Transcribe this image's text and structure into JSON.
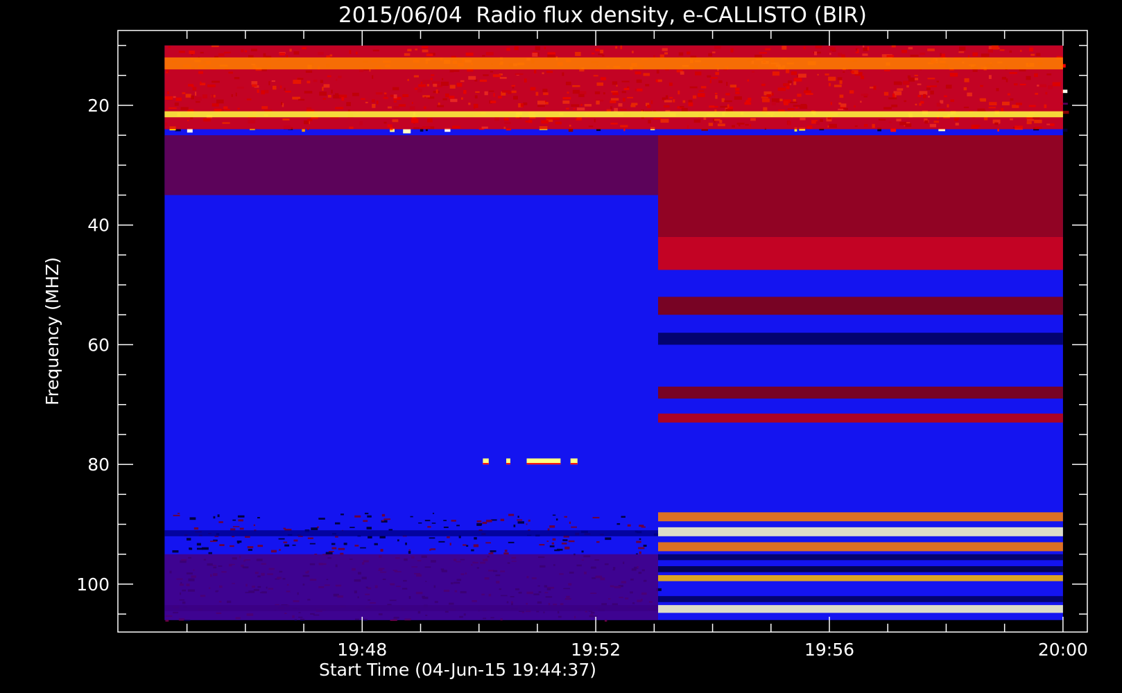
{
  "chart_data": {
    "type": "heatmap",
    "title": "2015/06/04  Radio flux density, e-CALLISTO (BIR)",
    "xlabel": "Start Time (04-Jun-15 19:44:37)",
    "ylabel": "Frequency (MHZ)",
    "x_unit": "minutes",
    "x_ticks": [
      {
        "value": 3.383,
        "label": "19:48"
      },
      {
        "value": 7.383,
        "label": "19:52"
      },
      {
        "value": 11.383,
        "label": "19:56"
      },
      {
        "value": 15.383,
        "label": "20:00"
      }
    ],
    "x_minor_ticks": [
      0.383,
      1.383,
      2.383,
      4.383,
      5.383,
      6.383,
      8.383,
      9.383,
      10.383,
      12.383,
      13.383,
      14.383
    ],
    "xlim": [
      -0.8,
      15.8
    ],
    "data_x_range": [
      0,
      15.383
    ],
    "segment_change_x": 8.45,
    "y_ticks": [
      {
        "value": 20,
        "label": "20"
      },
      {
        "value": 40,
        "label": "40"
      },
      {
        "value": 60,
        "label": "60"
      },
      {
        "value": 80,
        "label": "80"
      },
      {
        "value": 100,
        "label": "100"
      }
    ],
    "y_minor_ticks": [
      10,
      15,
      25,
      30,
      35,
      45,
      50,
      55,
      65,
      70,
      75,
      85,
      90,
      95,
      105
    ],
    "ylim": [
      7.5,
      108
    ],
    "data_y_range": [
      10,
      106
    ],
    "y_inverted": true,
    "colorscale": [
      "#000020",
      "#0000ff",
      "#8a0000",
      "#ff0000",
      "#ffff00",
      "#ffffff"
    ],
    "background_color": "#1414f0",
    "bands": [
      {
        "y_from": 10,
        "y_to": 24,
        "x_from": 0,
        "x_to": 15.383,
        "intensity": 0.55
      },
      {
        "y_from": 12,
        "y_to": 14,
        "x_from": 0,
        "x_to": 15.383,
        "intensity": 0.7
      },
      {
        "y_from": 21,
        "y_to": 22,
        "x_from": 0,
        "x_to": 15.383,
        "intensity": 0.85
      },
      {
        "y_from": 25,
        "y_to": 35,
        "x_from": 0,
        "x_to": 8.45,
        "intensity": 0.35
      },
      {
        "y_from": 25,
        "y_to": 42,
        "x_from": 8.45,
        "x_to": 15.383,
        "intensity": 0.45
      },
      {
        "y_from": 42,
        "y_to": 47.5,
        "x_from": 8.45,
        "x_to": 15.383,
        "intensity": 0.55
      },
      {
        "y_from": 52,
        "y_to": 55,
        "x_from": 8.45,
        "x_to": 15.383,
        "intensity": 0.4
      },
      {
        "y_from": 58,
        "y_to": 60,
        "x_from": 8.45,
        "x_to": 15.383,
        "intensity": 0.05
      },
      {
        "y_from": 67,
        "y_to": 69,
        "x_from": 8.45,
        "x_to": 15.383,
        "intensity": 0.4
      },
      {
        "y_from": 71.5,
        "y_to": 73,
        "x_from": 8.45,
        "x_to": 15.383,
        "intensity": 0.5
      },
      {
        "y_from": 88,
        "y_to": 89.5,
        "x_from": 8.45,
        "x_to": 15.383,
        "intensity": 0.7
      },
      {
        "y_from": 90.5,
        "y_to": 92,
        "x_from": 8.45,
        "x_to": 15.383,
        "intensity": 0.95
      },
      {
        "y_from": 93,
        "y_to": 94.5,
        "x_from": 8.45,
        "x_to": 15.383,
        "intensity": 0.7
      },
      {
        "y_from": 95,
        "y_to": 96,
        "x_from": 8.45,
        "x_to": 15.383,
        "intensity": 0.05
      },
      {
        "y_from": 97,
        "y_to": 98,
        "x_from": 8.45,
        "x_to": 15.383,
        "intensity": 0.02
      },
      {
        "y_from": 98.5,
        "y_to": 99.5,
        "x_from": 8.45,
        "x_to": 15.383,
        "intensity": 0.75
      },
      {
        "y_from": 102,
        "y_to": 103,
        "x_from": 8.45,
        "x_to": 15.383,
        "intensity": 0.05
      },
      {
        "y_from": 103.5,
        "y_to": 104.8,
        "x_from": 8.45,
        "x_to": 15.383,
        "intensity": 0.95
      },
      {
        "y_from": 91,
        "y_to": 92,
        "x_from": 0,
        "x_to": 8.45,
        "intensity": 0.1
      },
      {
        "y_from": 103.5,
        "y_to": 104.5,
        "x_from": 0,
        "x_to": 8.45,
        "intensity": 0.1
      },
      {
        "y_from": 95,
        "y_to": 106,
        "x_from": 0,
        "x_to": 8.45,
        "intensity": 0.3
      }
    ],
    "bursts": [
      {
        "x_from": 5.45,
        "x_to": 5.55,
        "y_from": 79,
        "y_to": 80,
        "intensity": 0.9
      },
      {
        "x_from": 5.85,
        "x_to": 5.92,
        "y_from": 79,
        "y_to": 80,
        "intensity": 0.9
      },
      {
        "x_from": 6.2,
        "x_to": 6.78,
        "y_from": 79,
        "y_to": 80,
        "intensity": 0.9
      },
      {
        "x_from": 6.95,
        "x_to": 7.07,
        "y_from": 79,
        "y_to": 80,
        "intensity": 0.9
      }
    ]
  }
}
